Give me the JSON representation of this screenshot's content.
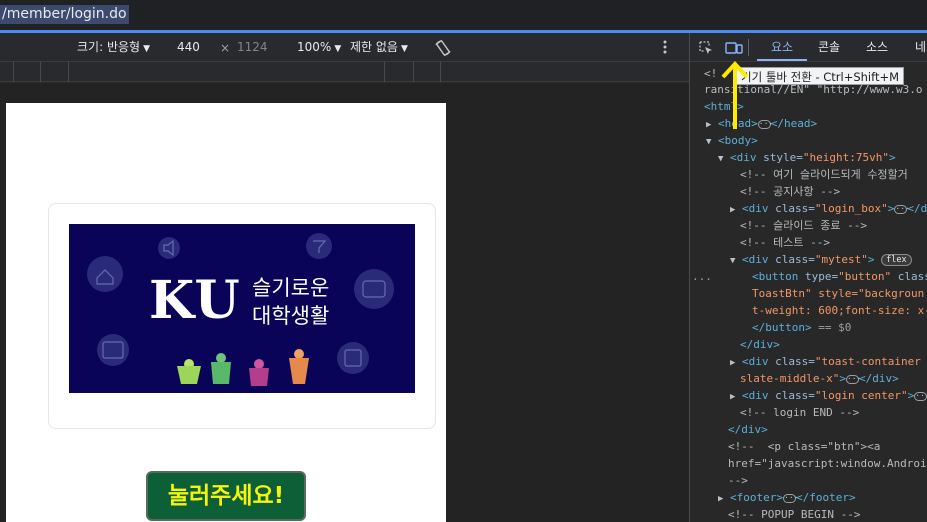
{
  "address_bar": {
    "url": "/member/login.do"
  },
  "device_toolbar": {
    "dimensions_label": "크기: 반응형",
    "width": "440",
    "times": "×",
    "height": "1124",
    "zoom": "100%",
    "throttle": "제한 없음",
    "rotate_icon": "rotate-icon",
    "more_icon": "kebab-icon"
  },
  "page": {
    "banner": {
      "logo_text": "KU",
      "subtitle_line1": "슬기로운",
      "subtitle_line2": "대학생활"
    },
    "toast_button": "눌러주세요!"
  },
  "devtools": {
    "tabs": [
      {
        "label": "요소",
        "active": true
      },
      {
        "label": "콘솔",
        "active": false
      },
      {
        "label": "소스",
        "active": false
      },
      {
        "label": "네",
        "active": false
      }
    ],
    "tooltip": "기기 툴바 전환 - Ctrl+Shift+M",
    "colors": {
      "accent": "#8ab4f8",
      "arrow": "#ffea00"
    },
    "dom": {
      "l0": "<!",
      "l1": "ransitional//EN\" \"http://www.w3.o",
      "l2": "<html>",
      "l3_open": "<head>",
      "l3_close": "</head>",
      "l4": "<body>",
      "l5_tag": "<div ",
      "l5_attr": "style=",
      "l5_val": "\"height:75vh\"",
      "l5_end": ">",
      "l6": "<!-- 여기 슬라이드되게 수정할거",
      "l7": "<!-- 공지사항 -->",
      "l8_tag": "<div ",
      "l8_attr": "class=",
      "l8_val": "\"login_box\"",
      "l8_end": ">",
      "l8_close": "</d",
      "l9": "<!-- 슬라이드 종료 -->",
      "l10": "<!-- 테스트 -->",
      "l11_tag": "<div ",
      "l11_attr": "class=",
      "l11_val": "\"mytest\"",
      "l11_end": ">",
      "l11_badge": "flex",
      "l12_tag": "<button ",
      "l12_attr": "type=",
      "l12_val": "\"button\"",
      "l12_attr2": " class",
      "l13": "ToastBtn\" style=\"backgroun",
      "l14": "t-weight: 600;font-size: x-",
      "l15_tag": "</button>",
      "l15_rest": " == $0",
      "l16": "</div>",
      "l17_tag": "<div ",
      "l17_attr": "class=",
      "l17_val": "\"toast-container p",
      "l18_val": "slate-middle-x\"",
      "l18_end": ">",
      "l18_close": "</div>",
      "l19_tag": "<div ",
      "l19_attr": "class=",
      "l19_val": "\"login center\"",
      "l19_end": ">",
      "l20": "<!-- login END -->",
      "l21": "</div>",
      "l22": "<!--  <p class=\"btn\"><a",
      "l23": "href=\"javascript:window.Androi",
      "l24": "-->",
      "l25_open": "<footer>",
      "l25_close": "</footer>",
      "l26": "<!-- POPUP BEGIN -->",
      "ellipsis_left": "..."
    }
  }
}
